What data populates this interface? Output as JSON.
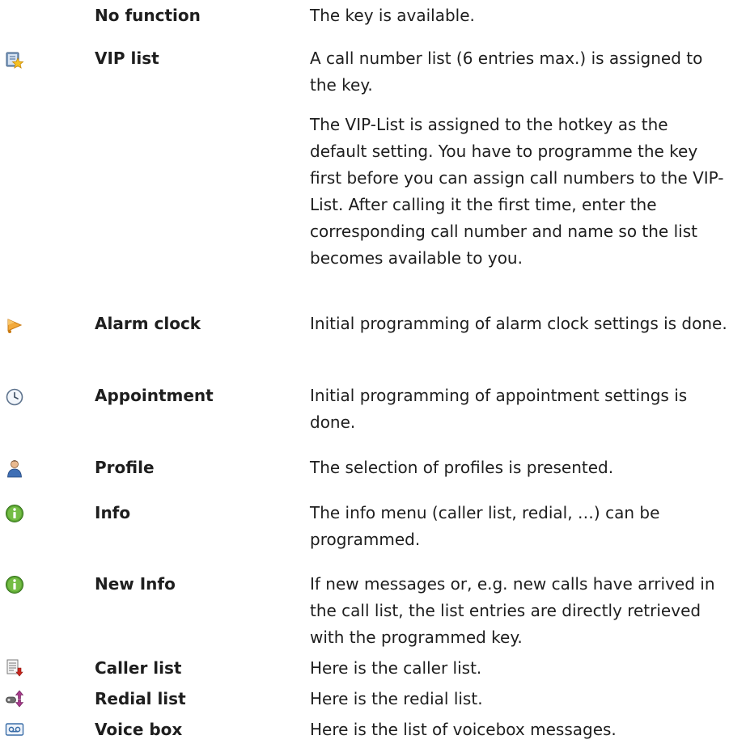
{
  "rows": [
    {
      "name": "No function",
      "icon": "",
      "desc": [
        "The key is available."
      ]
    },
    {
      "name": "VIP list",
      "icon": "vip-list-icon",
      "desc": [
        "A call number list (6 entries max.) is assigned to the key.",
        "The VIP-List is assigned to the hotkey as the default setting. You have to programme the key first before you can assign call numbers to the VIP-List. After calling it the first time, enter the corresponding call number and name so the list becomes available to you."
      ]
    },
    {
      "name": "Alarm clock",
      "icon": "alarm-bell-icon",
      "desc": [
        "Initial programming of alarm clock settings is done."
      ]
    },
    {
      "name": "Appointment",
      "icon": "clock-icon",
      "desc": [
        "Initial programming of appointment settings is done."
      ]
    },
    {
      "name": "Profile",
      "icon": "profile-person-icon",
      "desc": [
        "The selection of profiles is presented."
      ]
    },
    {
      "name": "Info",
      "icon": "info-icon",
      "desc": [
        "The info menu (caller list, redial, …) can be programmed."
      ]
    },
    {
      "name": "New Info",
      "icon": "info-icon",
      "desc": [
        "If new messages or, e.g. new calls have arrived in the call list, the list entries are directly retrieved with the programmed key."
      ]
    },
    {
      "name": "Caller list",
      "icon": "caller-list-icon",
      "desc": [
        "Here is the caller list."
      ]
    },
    {
      "name": "Redial list",
      "icon": "redial-list-icon",
      "desc": [
        "Here is the redial list."
      ]
    },
    {
      "name": "Voice box",
      "icon": "voicebox-icon",
      "desc": [
        "Here is the list of voicebox messages."
      ]
    }
  ]
}
